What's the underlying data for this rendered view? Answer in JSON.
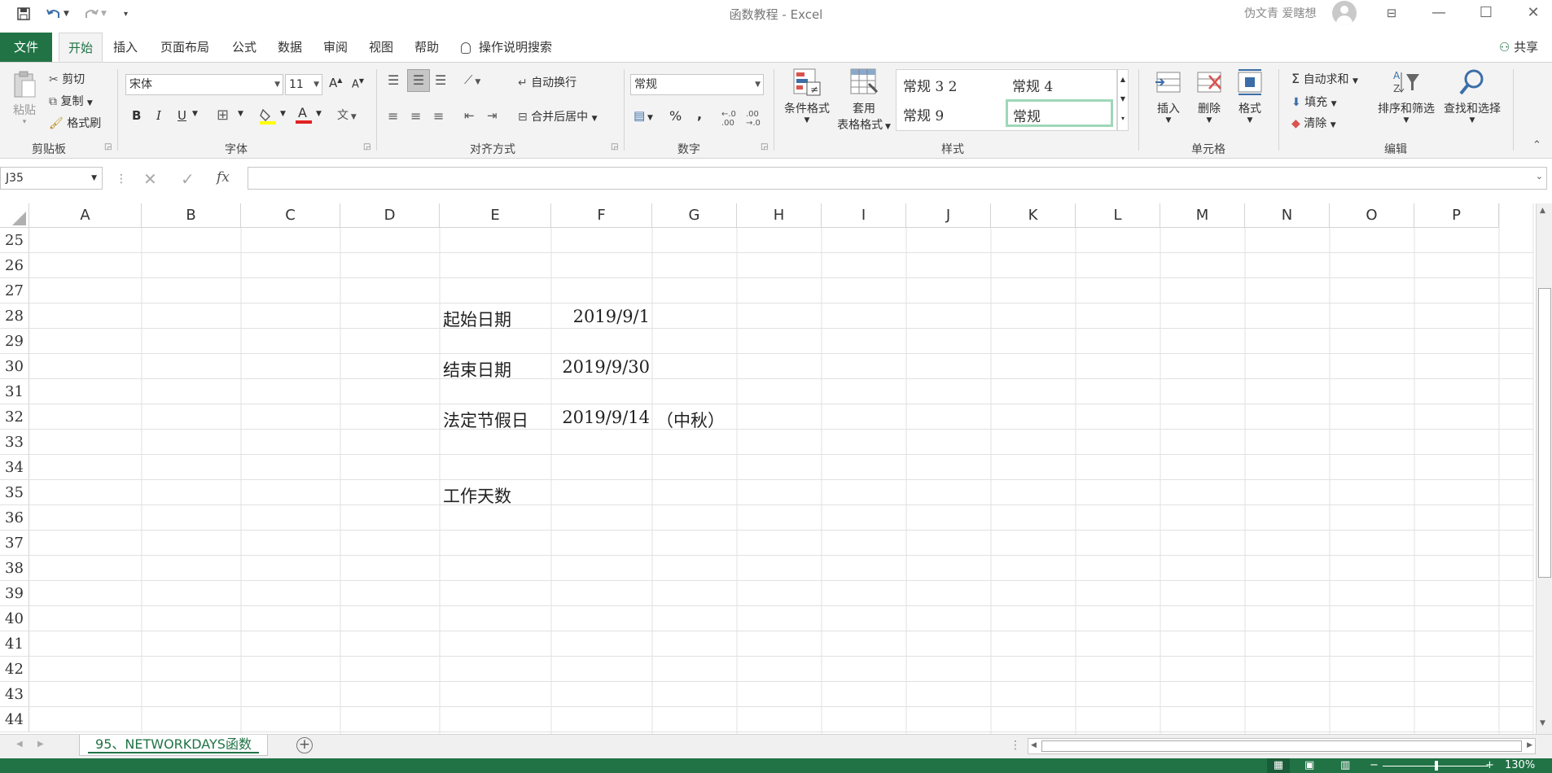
{
  "window": {
    "title": "函数教程  -  Excel",
    "user": "伪文青 爱瞎想",
    "minimize": "—",
    "maximize": "☐",
    "close": "✕"
  },
  "tabs": [
    "文件",
    "开始",
    "插入",
    "页面布局",
    "公式",
    "数据",
    "审阅",
    "视图",
    "帮助"
  ],
  "tell_me": "操作说明搜索",
  "share": "共享",
  "ribbon": {
    "clipboard": {
      "paste": "粘贴",
      "cut": "剪切",
      "copy": "复制",
      "format_painter": "格式刷",
      "label": "剪贴板"
    },
    "font": {
      "name": "宋体",
      "size": "11",
      "label": "字体",
      "bold": "B",
      "italic": "I",
      "underline": "U"
    },
    "alignment": {
      "wrap_text": "自动换行",
      "merge_center": "合并后居中",
      "label": "对齐方式"
    },
    "number": {
      "format": "常规",
      "label": "数字"
    },
    "styles": {
      "conditional_format": "条件格式",
      "table_format_1": "套用",
      "table_format_2": "表格格式",
      "label": "样式",
      "cells": [
        "常规 3 2",
        "常规 4",
        "常规 9",
        "常规"
      ]
    },
    "cells": {
      "insert": "插入",
      "delete": "删除",
      "format": "格式",
      "label": "单元格"
    },
    "editing": {
      "autosum": "自动求和",
      "fill": "填充",
      "clear": "清除",
      "sort_filter": "排序和筛选",
      "find_select": "查找和选择",
      "label": "编辑"
    }
  },
  "formula_bar": {
    "name_box": "J35",
    "fx": "fx",
    "value": ""
  },
  "columns": [
    "A",
    "B",
    "C",
    "D",
    "E",
    "F",
    "G",
    "H",
    "I",
    "J",
    "K",
    "L",
    "M",
    "N",
    "O",
    "P"
  ],
  "rows": [
    "25",
    "26",
    "27",
    "28",
    "29",
    "30",
    "31",
    "32",
    "33",
    "34",
    "35",
    "36",
    "37",
    "38",
    "39",
    "40",
    "41",
    "42",
    "43",
    "44"
  ],
  "cells": {
    "E28": "起始日期",
    "F28": "2019/9/1",
    "E30": "结束日期",
    "F30": "2019/9/30",
    "E32": "法定节假日",
    "F32": "2019/9/14",
    "G32": "（中秋）",
    "E35": "工作天数"
  },
  "sheet_tab": "95、NETWORKDAYS函数",
  "status": {
    "zoom": "130%"
  },
  "colors": {
    "accent": "#217346"
  }
}
